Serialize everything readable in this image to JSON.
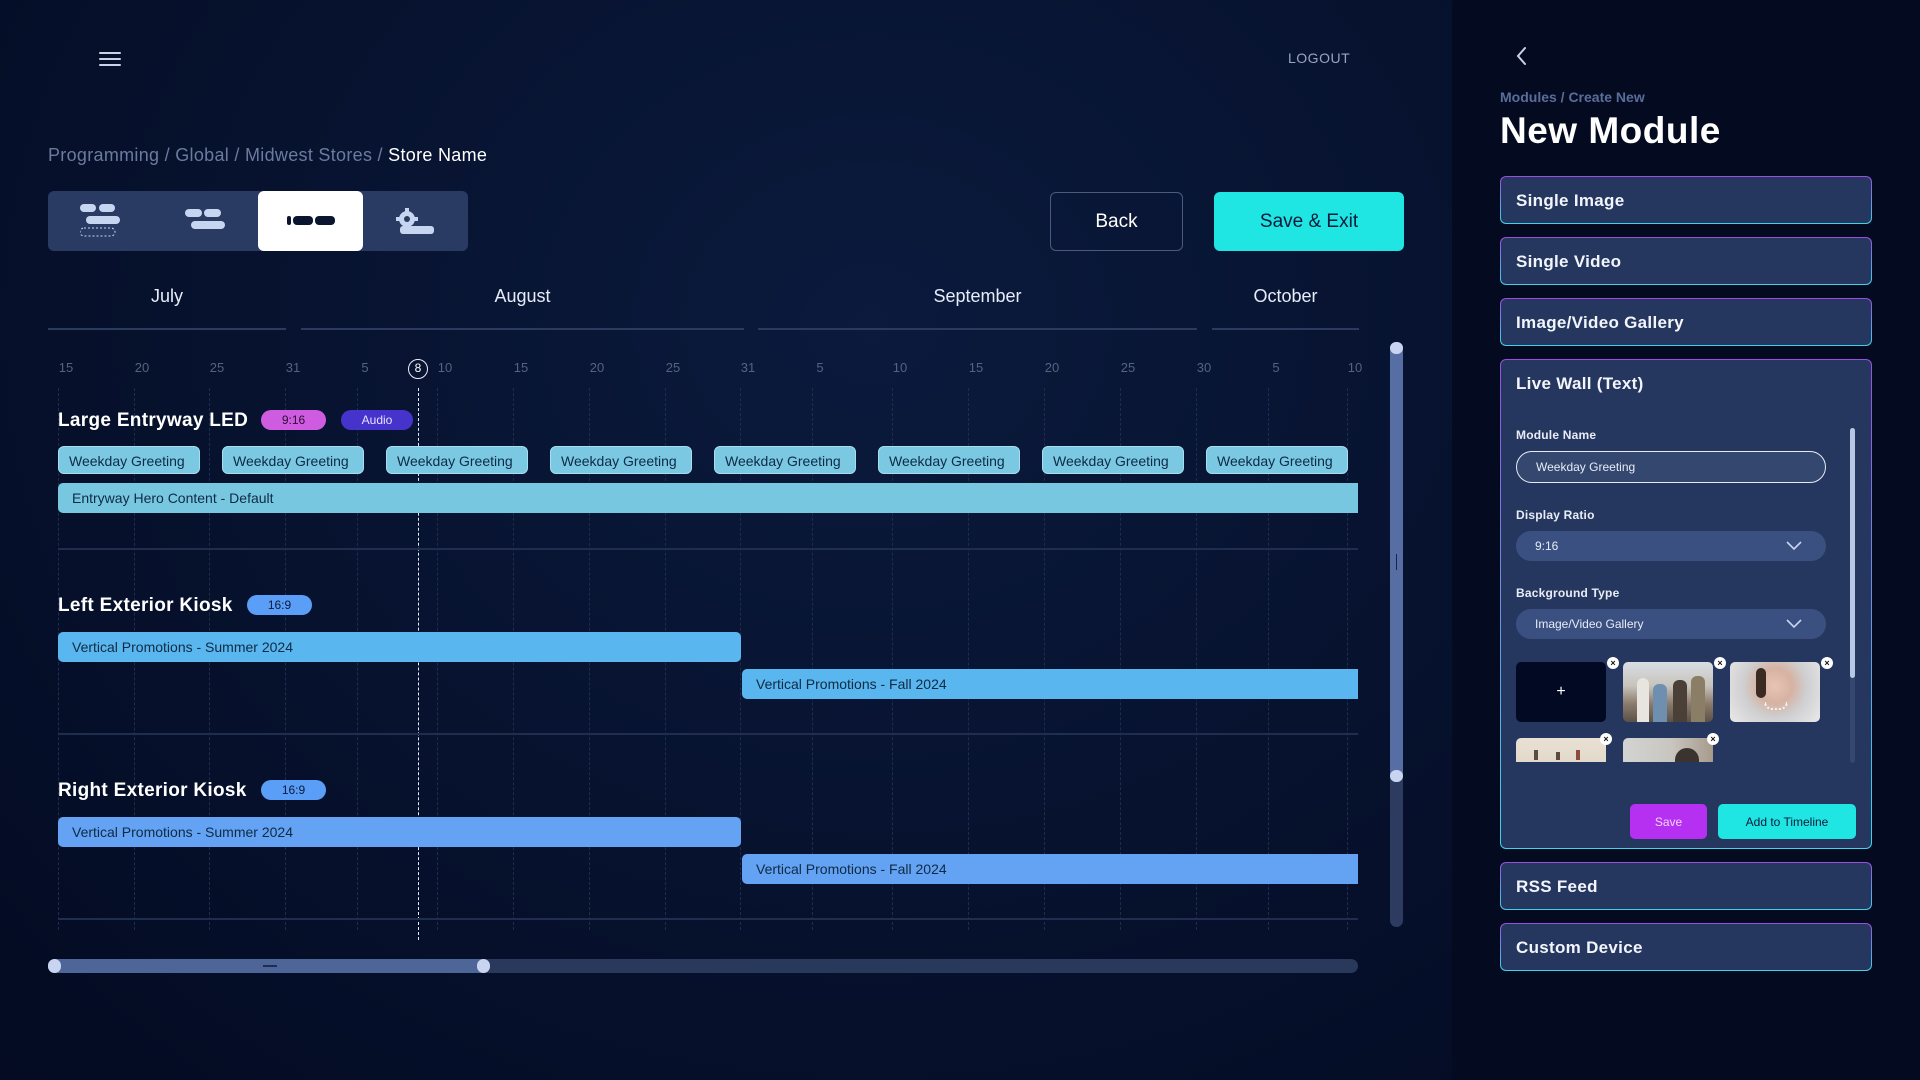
{
  "header": {
    "menu_icon": "hamburger-menu-icon",
    "logout_label": "LOGOUT"
  },
  "breadcrumb": {
    "items": [
      "Programming",
      "Global",
      "Midwest Stores"
    ],
    "separator": " / ",
    "current": "Store Name"
  },
  "view_switcher": {
    "options": [
      {
        "icon": "stacked-layout-icon",
        "active": false
      },
      {
        "icon": "grouped-layout-icon",
        "active": false
      },
      {
        "icon": "timeline-layout-icon",
        "active": true
      },
      {
        "icon": "settings-layout-icon",
        "active": false
      }
    ]
  },
  "actions": {
    "back_label": "Back",
    "save_exit_label": "Save & Exit"
  },
  "timeline": {
    "months": [
      "July",
      "August",
      "September",
      "October"
    ],
    "ticks": [
      "15",
      "20",
      "25",
      "31",
      "5",
      "10",
      "15",
      "20",
      "25",
      "31",
      "5",
      "10",
      "15",
      "20",
      "25",
      "30",
      "5",
      "10"
    ],
    "today_label": "8",
    "devices": [
      {
        "name": "Large Entryway LED",
        "badges": [
          {
            "label": "9:16",
            "kind": "ratio916"
          },
          {
            "label": "Audio",
            "kind": "audio"
          }
        ],
        "chips": [
          "Weekday Greeting",
          "Weekday Greeting",
          "Weekday Greeting",
          "Weekday Greeting",
          "Weekday Greeting",
          "Weekday Greeting",
          "Weekday Greeting",
          "Weekday Greeting"
        ],
        "bars": [
          {
            "label": "Entryway Hero Content - Default"
          }
        ]
      },
      {
        "name": "Left Exterior Kiosk",
        "badges": [
          {
            "label": "16:9",
            "kind": "ratio169"
          }
        ],
        "bars": [
          {
            "label": "Vertical Promotions - Summer 2024"
          },
          {
            "label": "Vertical Promotions - Fall 2024"
          }
        ]
      },
      {
        "name": "Right Exterior Kiosk",
        "badges": [
          {
            "label": "16:9",
            "kind": "ratio169"
          }
        ],
        "bars": [
          {
            "label": "Vertical Promotions - Summer 2024"
          },
          {
            "label": "Vertical Promotions - Fall 2024"
          }
        ]
      }
    ]
  },
  "side_panel": {
    "back_icon": "chevron-left-icon",
    "breadcrumb": "Modules / Create New",
    "title": "New Module",
    "modules": [
      {
        "label": "Single Image"
      },
      {
        "label": "Single Video"
      },
      {
        "label": "Image/Video Gallery"
      },
      {
        "label": "Live Wall (Text)",
        "expanded": true
      },
      {
        "label": "RSS Feed"
      },
      {
        "label": "Custom Device"
      }
    ],
    "form": {
      "module_name_label": "Module Name",
      "module_name_value": "Weekday Greeting",
      "display_ratio_label": "Display Ratio",
      "display_ratio_value": "9:16",
      "background_type_label": "Background Type",
      "background_type_value": "Image/Video Gallery",
      "add_media_label": "+",
      "remove_label": "×",
      "gallery": [
        "group-of-friends-photo",
        "woman-pearl-necklace-photo",
        "beach-people-photo",
        "city-building-photo"
      ],
      "save_label": "Save",
      "add_to_timeline_label": "Add to Timeline"
    }
  },
  "colors": {
    "accent_cyan": "#1fe6e2",
    "accent_purple": "#b530f0",
    "badge_916": "#cf5ce0",
    "badge_audio": "#4633cc",
    "badge_169": "#5a9ef7",
    "hero_bar": "#78c7e1",
    "left_kiosk_bar": "#5ab6ee",
    "right_kiosk_bar": "#64a2f3"
  }
}
